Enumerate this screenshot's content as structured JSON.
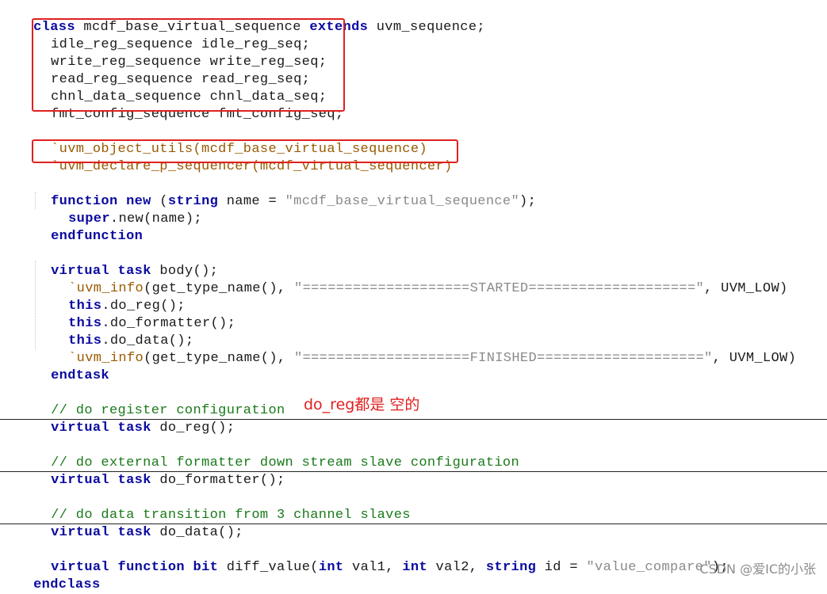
{
  "code": {
    "class_decl": "class mcdf_base_virtual_sequence extends uvm_sequence;",
    "fields": [
      "idle_reg_sequence idle_reg_seq;",
      "write_reg_sequence write_reg_seq;",
      "read_reg_sequence read_reg_seq;",
      "chnl_data_sequence chnl_data_seq;",
      "fmt_config_sequence fmt_config_seq;"
    ],
    "object_utils": "`uvm_object_utils(mcdf_base_virtual_sequence)",
    "declare_sequencer": "`uvm_declare_p_sequencer(mcdf_virtual_sequencer)",
    "func_new_kw": "function new",
    "func_new_args": "(string name = ",
    "func_new_str": "\"mcdf_base_virtual_sequence\"",
    "func_new_end": ");",
    "super_new": "super.new(name);",
    "endfunction": "endfunction",
    "task_body": "virtual task body();",
    "info_started_macro": "`uvm_info",
    "info_started_args": "(get_type_name(), ",
    "info_started_str": "\"====================STARTED====================\"",
    "info_started_end": ", UVM_LOW)",
    "call_do_reg": "this.do_reg();",
    "call_do_formatter": "this.do_formatter();",
    "call_do_data": "this.do_data();",
    "info_finished_macro": "`uvm_info",
    "info_finished_args": "(get_type_name(), ",
    "info_finished_str": "\"====================FINISHED====================\"",
    "info_finished_end": ", UVM_LOW)",
    "endtask": "endtask",
    "comment_reg": "// do register configuration",
    "task_do_reg": "virtual task do_reg();",
    "comment_formatter": "// do external formatter down stream slave configuration",
    "task_do_formatter": "virtual task do_formatter();",
    "comment_data": "// do data transition from 3 channel slaves",
    "task_do_data": "virtual task do_data();",
    "diff_value_head": "virtual function bit diff_value(int val1, int val2, string id = ",
    "diff_value_str": "\"value_compare\"",
    "diff_value_end": ");",
    "endclass": "endclass"
  },
  "annotation": "do_reg都是 空的",
  "watermark": "CSDN @爱IC的小张",
  "colors": {
    "keyword": "#0a0aa0",
    "macro": "#9a5a00",
    "string": "#8a8a8a",
    "comment": "#1a7a1a",
    "highlight_box": "#e02020"
  }
}
